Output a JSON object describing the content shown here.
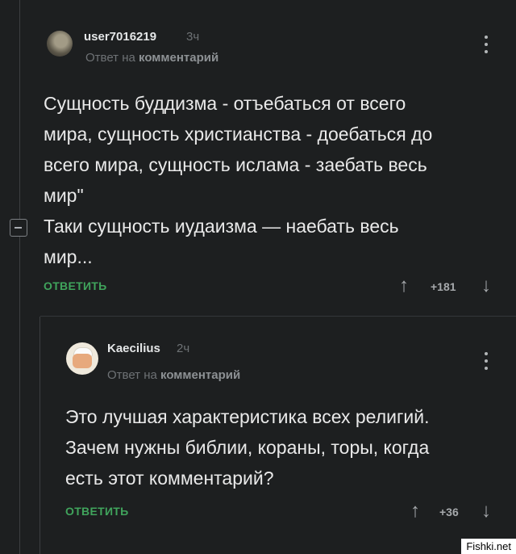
{
  "comments": [
    {
      "username": "user7016219",
      "time": "3ч",
      "reply_prefix": "Ответ на",
      "reply_target": "комментарий",
      "text_lines": [
        "Сущность буддизма - отъебаться от всего",
        "мира, сущность христианства - доебаться до",
        "всего мира, сущность ислама - заебать весь",
        "мир\"",
        "Таки сущность иудаизма — наебать весь",
        "мир..."
      ],
      "reply_label": "ОТВЕТИТЬ",
      "rating": "+181"
    },
    {
      "username": "Kaecilius",
      "time": "2ч",
      "reply_prefix": "Ответ на",
      "reply_target": "комментарий",
      "text_lines": [
        "Это лучшая характеристика всех религий.",
        "Зачем нужны библии, кораны, торы, когда",
        "есть этот комментарий?"
      ],
      "reply_label": "ОТВЕТИТЬ",
      "rating": "+36"
    }
  ],
  "icons": {
    "upvote": "↑",
    "downvote": "↓",
    "collapse": "minus-square-icon",
    "menu": "more-vertical-icon"
  },
  "colors": {
    "background": "#1d1f20",
    "accent": "#40a45c",
    "muted": "#6e7275"
  },
  "watermark": "Fishki.net"
}
